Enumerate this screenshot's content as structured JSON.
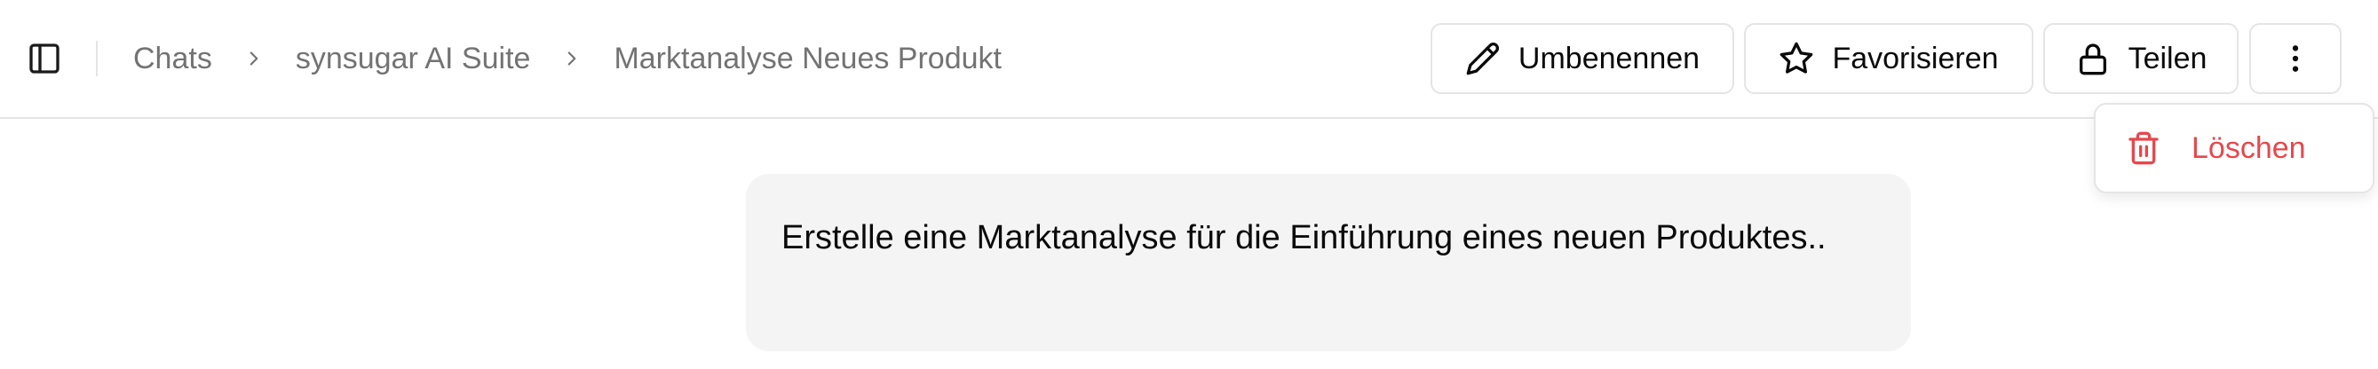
{
  "breadcrumb": {
    "items": [
      {
        "label": "Chats"
      },
      {
        "label": "synsugar AI Suite"
      },
      {
        "label": "Marktanalyse Neues Produkt"
      }
    ]
  },
  "toolbar": {
    "rename_label": "Umbenennen",
    "favorite_label": "Favorisieren",
    "share_label": "Teilen"
  },
  "menu": {
    "delete_label": "Löschen"
  },
  "message": {
    "text": "Erstelle eine Marktanalyse für die Einführung eines neuen Produktes.."
  },
  "colors": {
    "danger": "#e5484d",
    "muted": "#737373",
    "border": "#e5e5e5",
    "bubble": "#f4f4f4"
  },
  "icons": [
    "sidebar-icon",
    "chevron-right-icon",
    "pencil-icon",
    "star-icon",
    "lock-icon",
    "more-vertical-icon",
    "trash-icon"
  ]
}
